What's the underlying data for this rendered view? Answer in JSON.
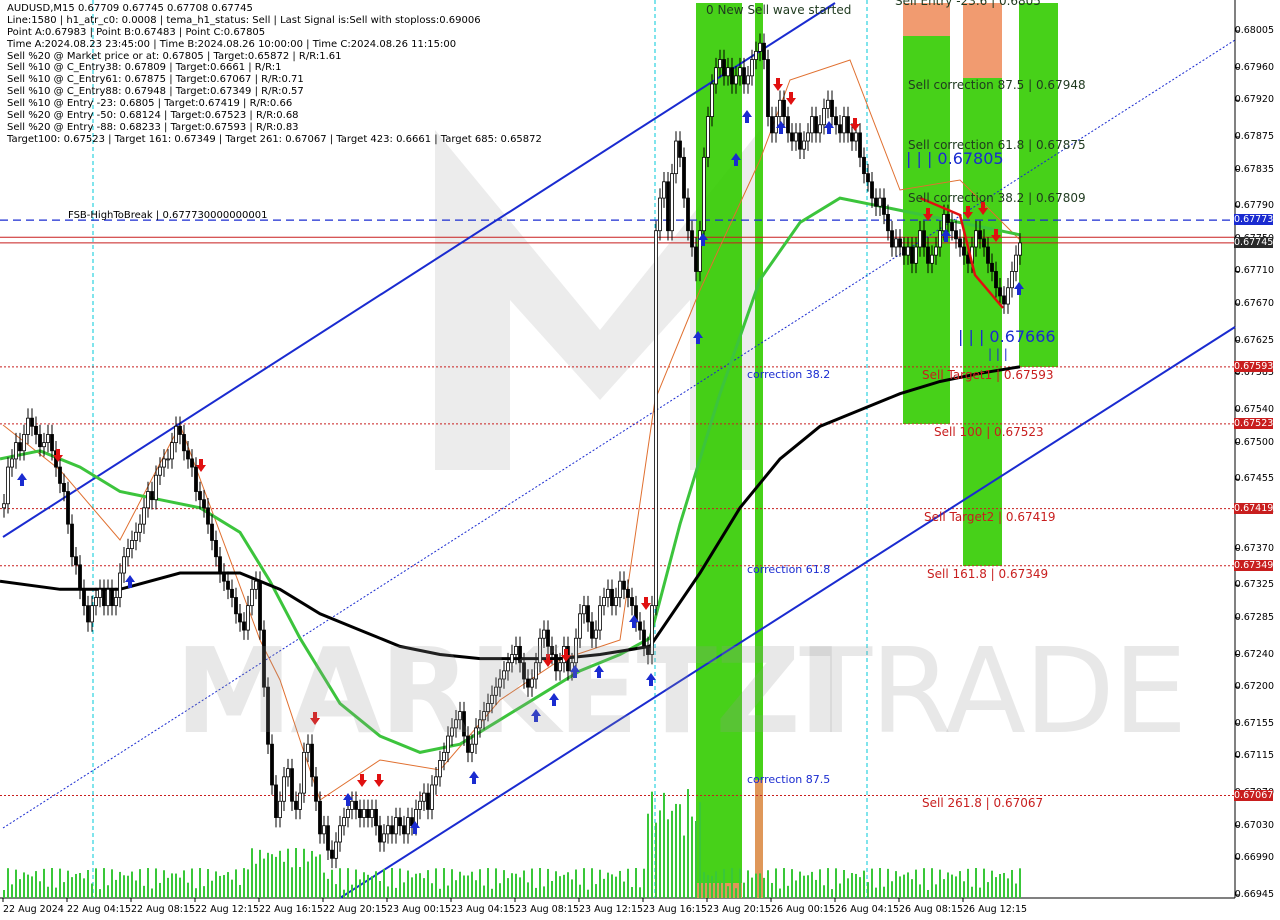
{
  "header": {
    "lines": [
      "AUDUSD,M15  0.67709 0.67745 0.67708 0.67745",
      "Line:1580  | h1_atr_c0: 0.0008  | tema_h1_status: Sell  | Last Signal is:Sell with stoploss:0.69006",
      "Point A:0.67983  | Point B:0.67483  | Point C:0.67805",
      "Time A:2024.08.23 23:45:00  | Time B:2024.08.26 10:00:00  | Time C:2024.08.26 11:15:00",
      "Sell %20 @ Market price or at: 0.67805  | Target:0.65872  | R/R:1.61",
      "Sell %10 @ C_Entry38: 0.67809  | Target:0.6661  | R/R:1",
      "Sell %10 @ C_Entry61: 0.67875  | Target:0.67067  | R/R:0.71",
      "Sell %10 @ C_Entry88: 0.67948  | Target:0.67349  | R/R:0.57",
      "Sell %10 @ Entry -23: 0.6805  | Target:0.67419  | R/R:0.66",
      "Sell %20 @ Entry -50: 0.68124  | Target:0.67523  | R/R:0.68",
      "Sell %20 @ Entry -88: 0.68233  | Target:0.67593  | R/R:0.83",
      "Target100: 0.67523  | Target 161: 0.67349  | Target 261: 0.67067  | Target 423: 0.6661  | Target 685: 0.65872"
    ]
  },
  "fsb_label": "FSB-HighToBreak  |  0.677730000000001",
  "levels": {
    "sell_entry": "Sell Entry -23.6 | 0.6805",
    "sell_corr_875": "Sell correction 87.5 | 0.67948",
    "sell_corr_618": "Sell correction 61.8 | 0.67875",
    "sell_corr_382": "Sell correction 38.2 | 0.67809",
    "sell_target1": "Sell Target1 | 0.67593",
    "sell_100": "Sell 100 | 0.67523",
    "sell_target2": "Sell Target2 | 0.67419",
    "sell_1618": "Sell 161.8 | 0.67349",
    "sell_2618": "Sell  261.8 | 0.67067",
    "wave_started": "0 New Sell wave started",
    "corr_382": "correction 38.2",
    "corr_618": "correction 61.8",
    "corr_875": "correction 87.5",
    "point_c": "| | | 0.67805",
    "point_b": "| | | 0.67666",
    "point_b_ticks": "| | |"
  },
  "watermark": {
    "left": "MARKETZI",
    "right": "TRADE"
  },
  "colors": {
    "bull_zone": "#33cc00",
    "bear_zone": "#f09060",
    "channel": "#1a2bd0",
    "ma_fast": "#3cc43c",
    "ma_slow": "#000000",
    "stop_line": "#e07030",
    "level_red": "#c81e1e",
    "axis_box_red": "#c81e1e",
    "axis_box_blue": "#1a2bd0",
    "axis_box_dark": "#2a2a2a"
  },
  "chart_data": {
    "type": "candlestick",
    "symbol": "AUDUSD",
    "timeframe": "M15",
    "ylim": [
      0.66945,
      0.6803
    ],
    "y_ticks": [
      "0.68005",
      "0.67960",
      "0.67920",
      "0.67875",
      "0.67835",
      "0.67790",
      "0.67750",
      "0.67710",
      "0.67670",
      "0.67625",
      "0.67585",
      "0.67540",
      "0.67500",
      "0.67455",
      "0.67415",
      "0.67370",
      "0.67325",
      "0.67285",
      "0.67240",
      "0.67200",
      "0.67155",
      "0.67115",
      "0.67070",
      "0.67030",
      "0.66990",
      "0.66945"
    ],
    "x_ticks": [
      "22 Aug 2024",
      "22 Aug 04:15",
      "22 Aug 08:15",
      "22 Aug 12:15",
      "22 Aug 16:15",
      "22 Aug 20:15",
      "23 Aug 00:15",
      "23 Aug 04:15",
      "23 Aug 08:15",
      "23 Aug 12:15",
      "23 Aug 16:15",
      "23 Aug 20:15",
      "26 Aug 00:15",
      "26 Aug 04:15",
      "26 Aug 08:15",
      "26 Aug 12:15"
    ],
    "axis_boxes": [
      {
        "value": "0.67773",
        "price": 0.67773,
        "style": "blue"
      },
      {
        "value": "0.67745",
        "price": 0.67745,
        "style": "dark"
      },
      {
        "value": "0.67593",
        "price": 0.67593,
        "style": "red"
      },
      {
        "value": "0.67523",
        "price": 0.67523,
        "style": "red"
      },
      {
        "value": "0.67419",
        "price": 0.67419,
        "style": "red"
      },
      {
        "value": "0.67349",
        "price": 0.67349,
        "style": "red"
      },
      {
        "value": "0.67067",
        "price": 0.67067,
        "style": "red"
      }
    ],
    "horizontal_levels": [
      0.67773,
      0.6775,
      0.67745,
      0.67593,
      0.67523,
      0.67419,
      0.67349,
      0.67067
    ],
    "close_path": [
      [
        0,
        0.6742
      ],
      [
        4,
        0.67425
      ],
      [
        8,
        0.6747
      ],
      [
        12,
        0.6748
      ],
      [
        16,
        0.675
      ],
      [
        20,
        0.6749
      ],
      [
        24,
        0.6751
      ],
      [
        28,
        0.6753
      ],
      [
        32,
        0.6752
      ],
      [
        36,
        0.6751
      ],
      [
        40,
        0.67495
      ],
      [
        44,
        0.675
      ],
      [
        48,
        0.6751
      ],
      [
        52,
        0.6749
      ],
      [
        56,
        0.6747
      ],
      [
        60,
        0.6745
      ],
      [
        64,
        0.6744
      ],
      [
        68,
        0.674
      ],
      [
        72,
        0.6736
      ],
      [
        76,
        0.6735
      ],
      [
        80,
        0.6732
      ],
      [
        84,
        0.673
      ],
      [
        88,
        0.6728
      ],
      [
        92,
        0.673
      ],
      [
        96,
        0.6731
      ],
      [
        100,
        0.6732
      ],
      [
        104,
        0.673
      ],
      [
        108,
        0.6732
      ],
      [
        112,
        0.673
      ],
      [
        116,
        0.6731
      ],
      [
        120,
        0.6734
      ],
      [
        124,
        0.6736
      ],
      [
        128,
        0.6737
      ],
      [
        132,
        0.6738
      ],
      [
        136,
        0.6739
      ],
      [
        140,
        0.674
      ],
      [
        144,
        0.6742
      ],
      [
        148,
        0.6744
      ],
      [
        152,
        0.6743
      ],
      [
        156,
        0.6746
      ],
      [
        160,
        0.6747
      ],
      [
        164,
        0.6748
      ],
      [
        168,
        0.6748
      ],
      [
        172,
        0.675
      ],
      [
        176,
        0.6752
      ],
      [
        180,
        0.6751
      ],
      [
        184,
        0.6749
      ],
      [
        188,
        0.6748
      ],
      [
        192,
        0.6747
      ],
      [
        196,
        0.6744
      ],
      [
        200,
        0.6743
      ],
      [
        204,
        0.6742
      ],
      [
        208,
        0.674
      ],
      [
        212,
        0.6738
      ],
      [
        216,
        0.6736
      ],
      [
        220,
        0.6734
      ],
      [
        224,
        0.6733
      ],
      [
        228,
        0.6732
      ],
      [
        232,
        0.6731
      ],
      [
        236,
        0.6729
      ],
      [
        240,
        0.6728
      ],
      [
        244,
        0.6727
      ],
      [
        248,
        0.673
      ],
      [
        252,
        0.6732
      ],
      [
        256,
        0.6733
      ],
      [
        260,
        0.6727
      ],
      [
        264,
        0.672
      ],
      [
        268,
        0.6713
      ],
      [
        272,
        0.6708
      ],
      [
        276,
        0.6704
      ],
      [
        280,
        0.6706
      ],
      [
        284,
        0.6709
      ],
      [
        288,
        0.671
      ],
      [
        292,
        0.6706
      ],
      [
        296,
        0.6705
      ],
      [
        300,
        0.6707
      ],
      [
        304,
        0.6712
      ],
      [
        308,
        0.6713
      ],
      [
        312,
        0.6709
      ],
      [
        316,
        0.6706
      ],
      [
        320,
        0.6702
      ],
      [
        324,
        0.6703
      ],
      [
        328,
        0.67
      ],
      [
        332,
        0.6699
      ],
      [
        336,
        0.6701
      ],
      [
        340,
        0.6703
      ],
      [
        344,
        0.6704
      ],
      [
        348,
        0.6705
      ],
      [
        352,
        0.6706
      ],
      [
        356,
        0.6705
      ],
      [
        360,
        0.6704
      ],
      [
        364,
        0.6705
      ],
      [
        368,
        0.6704
      ],
      [
        372,
        0.6705
      ],
      [
        376,
        0.6703
      ],
      [
        380,
        0.6701
      ],
      [
        384,
        0.6702
      ],
      [
        388,
        0.6703
      ],
      [
        392,
        0.6702
      ],
      [
        396,
        0.6704
      ],
      [
        400,
        0.6703
      ],
      [
        404,
        0.6702
      ],
      [
        408,
        0.6704
      ],
      [
        412,
        0.6703
      ],
      [
        416,
        0.6705
      ],
      [
        420,
        0.6706
      ],
      [
        424,
        0.6707
      ],
      [
        428,
        0.6705
      ],
      [
        432,
        0.6708
      ],
      [
        436,
        0.6709
      ],
      [
        440,
        0.6711
      ],
      [
        444,
        0.6712
      ],
      [
        448,
        0.6714
      ],
      [
        452,
        0.6715
      ],
      [
        456,
        0.6716
      ],
      [
        460,
        0.6717
      ],
      [
        464,
        0.6714
      ],
      [
        468,
        0.6712
      ],
      [
        472,
        0.6713
      ],
      [
        476,
        0.6715
      ],
      [
        480,
        0.6716
      ],
      [
        484,
        0.6717
      ],
      [
        488,
        0.6718
      ],
      [
        492,
        0.6719
      ],
      [
        496,
        0.672
      ],
      [
        500,
        0.6721
      ],
      [
        504,
        0.6722
      ],
      [
        508,
        0.6723
      ],
      [
        512,
        0.6724
      ],
      [
        516,
        0.6725
      ],
      [
        520,
        0.6723
      ],
      [
        524,
        0.6721
      ],
      [
        528,
        0.672
      ],
      [
        532,
        0.6721
      ],
      [
        536,
        0.6723
      ],
      [
        540,
        0.6726
      ],
      [
        544,
        0.6727
      ],
      [
        548,
        0.6725
      ],
      [
        552,
        0.6724
      ],
      [
        556,
        0.6722
      ],
      [
        560,
        0.6723
      ],
      [
        564,
        0.6725
      ],
      [
        568,
        0.6722
      ],
      [
        572,
        0.6723
      ],
      [
        576,
        0.6726
      ],
      [
        580,
        0.6729
      ],
      [
        584,
        0.673
      ],
      [
        588,
        0.6728
      ],
      [
        592,
        0.6726
      ],
      [
        596,
        0.6727
      ],
      [
        600,
        0.673
      ],
      [
        604,
        0.6731
      ],
      [
        608,
        0.6732
      ],
      [
        612,
        0.673
      ],
      [
        616,
        0.6731
      ],
      [
        620,
        0.6733
      ],
      [
        624,
        0.6732
      ],
      [
        628,
        0.6731
      ],
      [
        632,
        0.673
      ],
      [
        636,
        0.6728
      ],
      [
        640,
        0.6727
      ],
      [
        644,
        0.6725
      ],
      [
        648,
        0.6724
      ],
      [
        652,
        0.673
      ],
      [
        656,
        0.6776
      ],
      [
        660,
        0.678
      ],
      [
        664,
        0.6782
      ],
      [
        668,
        0.6776
      ],
      [
        672,
        0.6783
      ],
      [
        676,
        0.6787
      ],
      [
        680,
        0.6785
      ],
      [
        684,
        0.678
      ],
      [
        688,
        0.6776
      ],
      [
        692,
        0.6774
      ],
      [
        696,
        0.6771
      ],
      [
        700,
        0.6776
      ],
      [
        704,
        0.6785
      ],
      [
        708,
        0.679
      ],
      [
        712,
        0.6794
      ],
      [
        716,
        0.6796
      ],
      [
        720,
        0.6797
      ],
      [
        724,
        0.6795
      ],
      [
        728,
        0.6796
      ],
      [
        732,
        0.6794
      ],
      [
        736,
        0.6795
      ],
      [
        740,
        0.6796
      ],
      [
        744,
        0.6794
      ],
      [
        748,
        0.6795
      ],
      [
        752,
        0.6797
      ],
      [
        756,
        0.6798
      ],
      [
        760,
        0.6799
      ],
      [
        764,
        0.6797
      ],
      [
        768,
        0.679
      ],
      [
        772,
        0.6788
      ],
      [
        776,
        0.679
      ],
      [
        780,
        0.6792
      ],
      [
        784,
        0.679
      ],
      [
        788,
        0.6788
      ],
      [
        792,
        0.6787
      ],
      [
        796,
        0.6788
      ],
      [
        800,
        0.6786
      ],
      [
        804,
        0.6787
      ],
      [
        808,
        0.6788
      ],
      [
        812,
        0.679
      ],
      [
        816,
        0.6788
      ],
      [
        820,
        0.6789
      ],
      [
        824,
        0.6791
      ],
      [
        828,
        0.6792
      ],
      [
        832,
        0.679
      ],
      [
        836,
        0.6789
      ],
      [
        840,
        0.6788
      ],
      [
        844,
        0.679
      ],
      [
        848,
        0.6788
      ],
      [
        852,
        0.6787
      ],
      [
        856,
        0.6788
      ],
      [
        860,
        0.6785
      ],
      [
        864,
        0.6783
      ],
      [
        868,
        0.6782
      ],
      [
        872,
        0.678
      ],
      [
        876,
        0.6779
      ],
      [
        880,
        0.678
      ],
      [
        884,
        0.6778
      ],
      [
        888,
        0.6776
      ],
      [
        892,
        0.6774
      ],
      [
        896,
        0.6775
      ],
      [
        900,
        0.6774
      ],
      [
        904,
        0.6773
      ],
      [
        908,
        0.6774
      ],
      [
        912,
        0.6772
      ],
      [
        916,
        0.6774
      ],
      [
        920,
        0.6776
      ],
      [
        924,
        0.6774
      ],
      [
        928,
        0.6772
      ],
      [
        932,
        0.6773
      ],
      [
        936,
        0.6774
      ],
      [
        940,
        0.6776
      ],
      [
        944,
        0.6778
      ],
      [
        948,
        0.6777
      ],
      [
        952,
        0.6776
      ],
      [
        956,
        0.6775
      ],
      [
        960,
        0.6774
      ],
      [
        964,
        0.6773
      ],
      [
        968,
        0.6772
      ],
      [
        972,
        0.6774
      ],
      [
        976,
        0.6776
      ],
      [
        980,
        0.6775
      ],
      [
        984,
        0.6774
      ],
      [
        988,
        0.6772
      ],
      [
        992,
        0.6771
      ],
      [
        996,
        0.6769
      ],
      [
        1000,
        0.6768
      ],
      [
        1004,
        0.6767
      ],
      [
        1008,
        0.6769
      ],
      [
        1012,
        0.6771
      ],
      [
        1016,
        0.6773
      ],
      [
        1020,
        0.67745
      ]
    ],
    "ma_fast": [
      [
        0,
        0.6748
      ],
      [
        40,
        0.6749
      ],
      [
        80,
        0.6747
      ],
      [
        120,
        0.6744
      ],
      [
        160,
        0.6743
      ],
      [
        200,
        0.6742
      ],
      [
        240,
        0.6739
      ],
      [
        270,
        0.6733
      ],
      [
        300,
        0.6726
      ],
      [
        340,
        0.6718
      ],
      [
        380,
        0.6714
      ],
      [
        420,
        0.6712
      ],
      [
        460,
        0.6713
      ],
      [
        500,
        0.6716
      ],
      [
        540,
        0.6719
      ],
      [
        580,
        0.6722
      ],
      [
        620,
        0.6724
      ],
      [
        650,
        0.6726
      ],
      [
        680,
        0.674
      ],
      [
        720,
        0.6756
      ],
      [
        760,
        0.677
      ],
      [
        800,
        0.6777
      ],
      [
        840,
        0.678
      ],
      [
        880,
        0.6779
      ],
      [
        920,
        0.6778
      ],
      [
        960,
        0.6777
      ],
      [
        1000,
        0.6776
      ],
      [
        1020,
        0.67755
      ]
    ],
    "ma_slow": [
      [
        0,
        0.6733
      ],
      [
        60,
        0.6732
      ],
      [
        120,
        0.6732
      ],
      [
        180,
        0.6734
      ],
      [
        240,
        0.6734
      ],
      [
        280,
        0.6732
      ],
      [
        320,
        0.6729
      ],
      [
        360,
        0.6727
      ],
      [
        400,
        0.6725
      ],
      [
        440,
        0.6724
      ],
      [
        480,
        0.67235
      ],
      [
        520,
        0.67235
      ],
      [
        560,
        0.67235
      ],
      [
        600,
        0.6724
      ],
      [
        650,
        0.6725
      ],
      [
        700,
        0.6734
      ],
      [
        740,
        0.6742
      ],
      [
        780,
        0.6748
      ],
      [
        820,
        0.6752
      ],
      [
        860,
        0.6754
      ],
      [
        900,
        0.6756
      ],
      [
        940,
        0.67575
      ],
      [
        980,
        0.67585
      ],
      [
        1020,
        0.67593
      ]
    ]
  }
}
